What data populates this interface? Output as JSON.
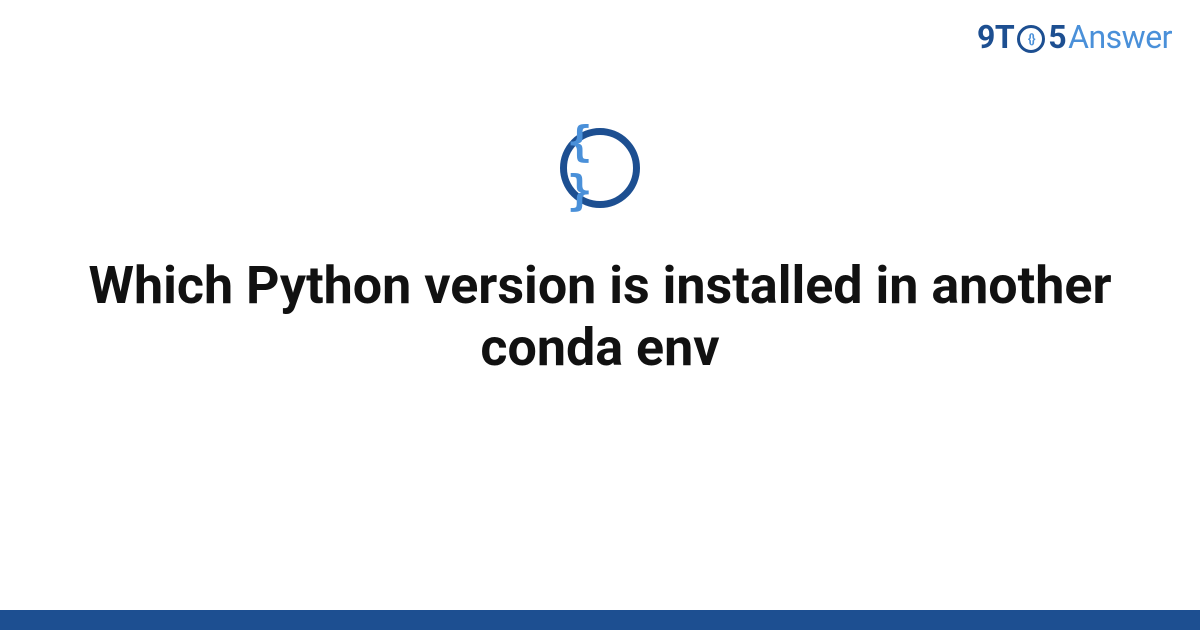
{
  "brand": {
    "part1": "9T",
    "circle_inner": "{}",
    "part2": "5",
    "part3": "Answer"
  },
  "icon": {
    "braces": "{ }",
    "semantic": "code-braces-icon"
  },
  "title": "Which Python version is installed in another conda env",
  "colors": {
    "primary_dark": "#1d4f91",
    "primary_light": "#4a90d9",
    "text": "#111111",
    "background": "#ffffff"
  }
}
